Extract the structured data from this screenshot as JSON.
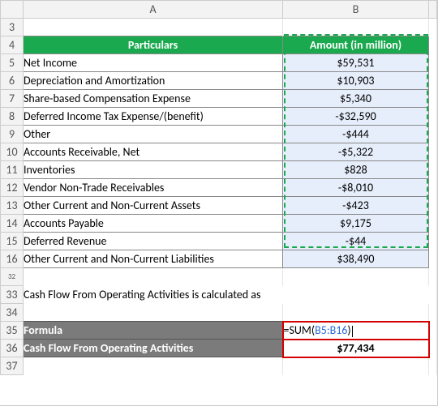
{
  "columns": {
    "A": "A",
    "B": "B"
  },
  "rows": {
    "r3": "3",
    "r4": "4",
    "r5": "5",
    "r6": "6",
    "r7": "7",
    "r8": "8",
    "r9": "9",
    "r10": "10",
    "r11": "11",
    "r12": "12",
    "r13": "13",
    "r14": "14",
    "r15": "15",
    "r16": "16",
    "r32": "32",
    "r33": "33",
    "r34": "34",
    "r35": "35",
    "r36": "36",
    "r37": "37"
  },
  "headers": {
    "particulars": "Particulars",
    "amount": "Amount (in million)"
  },
  "items": [
    {
      "label": "Net Income",
      "value": "$59,531"
    },
    {
      "label": "Depreciation and Amortization",
      "value": "$10,903"
    },
    {
      "label": "Share-based Compensation Expense",
      "value": "$5,340"
    },
    {
      "label": "Deferred Income Tax Expense/(benefit)",
      "value": "-$32,590"
    },
    {
      "label": "Other",
      "value": "-$444"
    },
    {
      "label": "Accounts Receivable, Net",
      "value": "-$5,322"
    },
    {
      "label": "Inventories",
      "value": "$828"
    },
    {
      "label": "Vendor Non-Trade Receivables",
      "value": "-$8,010"
    },
    {
      "label": "Other Current and Non-Current Assets",
      "value": "-$423"
    },
    {
      "label": "Accounts Payable",
      "value": "$9,175"
    },
    {
      "label": "Deferred Revenue",
      "value": "-$44"
    },
    {
      "label": "Other Current and Non-Current Liabilities",
      "value": "$38,490"
    }
  ],
  "note": "Cash Flow From Operating Activities is calculated as",
  "formula_row": {
    "label": "Formula",
    "eq": "=",
    "fn": "SUM(",
    "range": "B5:B16",
    "close": ")"
  },
  "result_row": {
    "label": "Cash Flow From Operating Activities",
    "value": "$77,434"
  },
  "chart_data": {
    "type": "table",
    "title": "Cash Flow From Operating Activities",
    "columns": [
      "Particulars",
      "Amount (in million)"
    ],
    "rows": [
      [
        "Net Income",
        59531
      ],
      [
        "Depreciation and Amortization",
        10903
      ],
      [
        "Share-based Compensation Expense",
        5340
      ],
      [
        "Deferred Income Tax Expense/(benefit)",
        -32590
      ],
      [
        "Other",
        -444
      ],
      [
        "Accounts Receivable, Net",
        -5322
      ],
      [
        "Inventories",
        828
      ],
      [
        "Vendor Non-Trade Receivables",
        -8010
      ],
      [
        "Other Current and Non-Current Assets",
        -423
      ],
      [
        "Accounts Payable",
        9175
      ],
      [
        "Deferred Revenue",
        -44
      ],
      [
        "Other Current and Non-Current Liabilities",
        38490
      ]
    ],
    "formula": "=SUM(B5:B16)",
    "result": 77434
  }
}
